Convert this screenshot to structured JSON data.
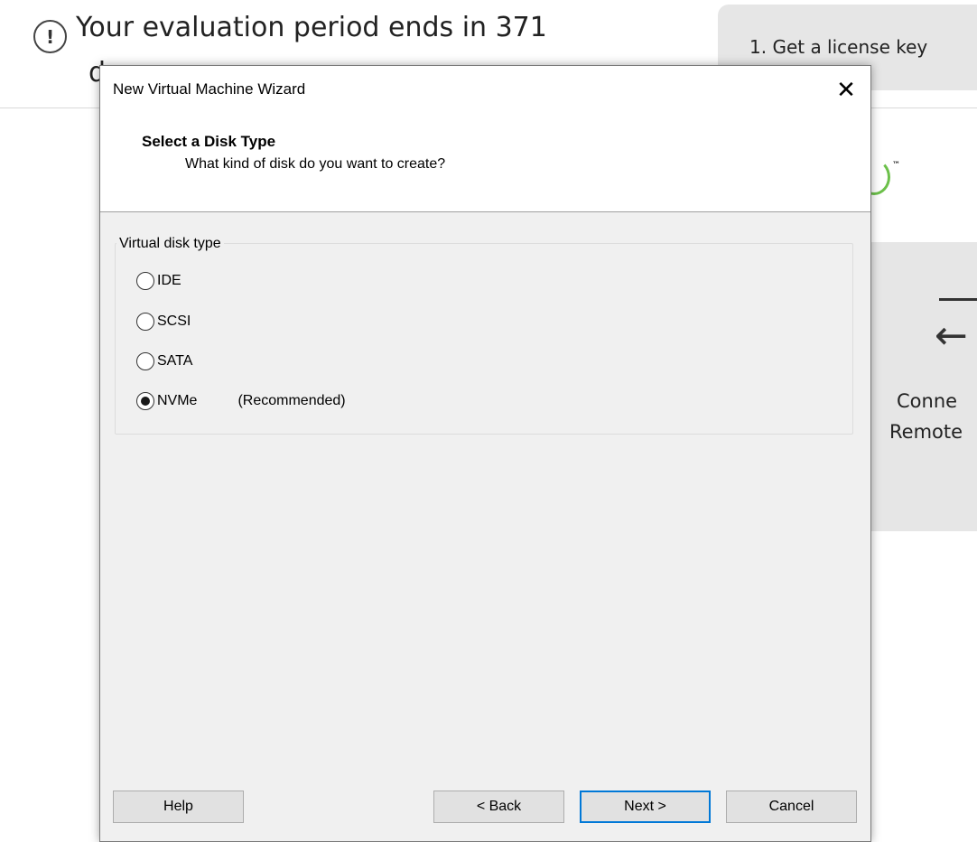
{
  "background": {
    "eval_notice_line1": "Your evaluation period ends in 371",
    "eval_notice_line2": "d",
    "eval_icon": "exclamation-circle-icon",
    "license_step": "1. Get a license key",
    "remote_line1": "Conne",
    "remote_line2": "Remote",
    "remote_icon": "arrow-left-icon",
    "trademark": "™"
  },
  "dialog": {
    "title": "New Virtual Machine Wizard",
    "close_glyph": "✕",
    "header": {
      "title": "Select a Disk Type",
      "subtitle": "What kind of disk do you want to create?"
    },
    "group_label": "Virtual disk type",
    "options": [
      {
        "label": "IDE",
        "selected": false,
        "note": ""
      },
      {
        "label": "SCSI",
        "selected": false,
        "note": ""
      },
      {
        "label": "SATA",
        "selected": false,
        "note": ""
      },
      {
        "label": "NVMe",
        "selected": true,
        "note": "(Recommended)"
      }
    ],
    "buttons": {
      "help": "Help",
      "back": "< Back",
      "next": "Next >",
      "cancel": "Cancel"
    },
    "colors": {
      "default_button_border": "#0078d7",
      "dialog_bg": "#f0f0f0"
    }
  }
}
